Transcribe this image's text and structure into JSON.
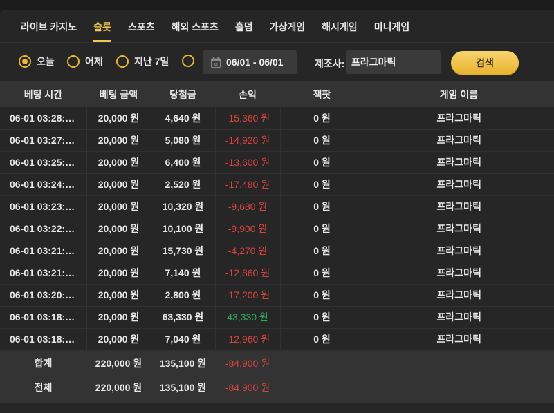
{
  "tabs": [
    {
      "label": "라이브 카지노",
      "active": false
    },
    {
      "label": "슬롯",
      "active": true
    },
    {
      "label": "스포츠",
      "active": false
    },
    {
      "label": "해외 스포츠",
      "active": false
    },
    {
      "label": "홀덤",
      "active": false
    },
    {
      "label": "가상게임",
      "active": false
    },
    {
      "label": "해시게임",
      "active": false
    },
    {
      "label": "미니게임",
      "active": false
    }
  ],
  "filter": {
    "radios": [
      {
        "label": "오늘",
        "selected": true
      },
      {
        "label": "어제",
        "selected": false
      },
      {
        "label": "지난 7일",
        "selected": false
      },
      {
        "label": "",
        "selected": false
      }
    ],
    "date_range": "06/01 - 06/01",
    "calendar_icon": "calendar-icon",
    "calendar_day": "31",
    "provider_label": "제조사:",
    "provider_value": "프라그마틱",
    "search_label": "검색"
  },
  "colors": {
    "accent": "#f2c94c",
    "negative": "#d9443c",
    "positive": "#2eae5a"
  },
  "table": {
    "headers": [
      "베팅 시간",
      "베팅 금액",
      "당첨금",
      "손익",
      "잭팟",
      "게임 이름"
    ],
    "rows": [
      {
        "time": "06-01 03:28:…",
        "bet": "20,000 원",
        "win": "4,640 원",
        "pnl": "-15,360 원",
        "pnl_sign": "neg",
        "jackpot": "0 원",
        "game": "프라그마틱"
      },
      {
        "time": "06-01 03:27:…",
        "bet": "20,000 원",
        "win": "5,080 원",
        "pnl": "-14,920 원",
        "pnl_sign": "neg",
        "jackpot": "0 원",
        "game": "프라그마틱"
      },
      {
        "time": "06-01 03:25:…",
        "bet": "20,000 원",
        "win": "6,400 원",
        "pnl": "-13,600 원",
        "pnl_sign": "neg",
        "jackpot": "0 원",
        "game": "프라그마틱"
      },
      {
        "time": "06-01 03:24:…",
        "bet": "20,000 원",
        "win": "2,520 원",
        "pnl": "-17,480 원",
        "pnl_sign": "neg",
        "jackpot": "0 원",
        "game": "프라그마틱"
      },
      {
        "time": "06-01 03:23:…",
        "bet": "20,000 원",
        "win": "10,320 원",
        "pnl": "-9,680 원",
        "pnl_sign": "neg",
        "jackpot": "0 원",
        "game": "프라그마틱"
      },
      {
        "time": "06-01 03:22:…",
        "bet": "20,000 원",
        "win": "10,100 원",
        "pnl": "-9,900 원",
        "pnl_sign": "neg",
        "jackpot": "0 원",
        "game": "프라그마틱"
      },
      {
        "time": "06-01 03:21:…",
        "bet": "20,000 원",
        "win": "15,730 원",
        "pnl": "-4,270 원",
        "pnl_sign": "neg",
        "jackpot": "0 원",
        "game": "프라그마틱"
      },
      {
        "time": "06-01 03:21:…",
        "bet": "20,000 원",
        "win": "7,140 원",
        "pnl": "-12,860 원",
        "pnl_sign": "neg",
        "jackpot": "0 원",
        "game": "프라그마틱"
      },
      {
        "time": "06-01 03:20:…",
        "bet": "20,000 원",
        "win": "2,800 원",
        "pnl": "-17,200 원",
        "pnl_sign": "neg",
        "jackpot": "0 원",
        "game": "프라그마틱"
      },
      {
        "time": "06-01 03:18:…",
        "bet": "20,000 원",
        "win": "63,330 원",
        "pnl": "43,330 원",
        "pnl_sign": "pos",
        "jackpot": "0 원",
        "game": "프라그마틱"
      },
      {
        "time": "06-01 03:18:…",
        "bet": "20,000 원",
        "win": "7,040 원",
        "pnl": "-12,960 원",
        "pnl_sign": "neg",
        "jackpot": "0 원",
        "game": "프라그마틱"
      }
    ],
    "totals": [
      {
        "label": "합계",
        "bet": "220,000 원",
        "win": "135,100 원",
        "pnl": "-84,900 원"
      },
      {
        "label": "전체",
        "bet": "220,000 원",
        "win": "135,100 원",
        "pnl": "-84,900 원"
      }
    ]
  }
}
